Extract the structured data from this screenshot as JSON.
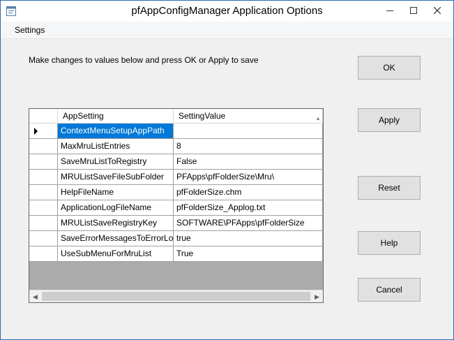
{
  "window": {
    "title": "pfAppConfigManager Application Options"
  },
  "menu": {
    "settings_label": "Settings"
  },
  "instruction": "Make changes to values below and press OK or Apply to save",
  "buttons": {
    "ok": "OK",
    "apply": "Apply",
    "reset": "Reset",
    "help": "Help",
    "cancel": "Cancel"
  },
  "grid": {
    "columns": [
      "AppSetting",
      "SettingValue"
    ],
    "rows": [
      {
        "setting": "ContextMenuSetupAppPath",
        "value": "",
        "selected": true
      },
      {
        "setting": "MaxMruListEntries",
        "value": "8"
      },
      {
        "setting": "SaveMruListToRegistry",
        "value": "False"
      },
      {
        "setting": "MRUListSaveFileSubFolder",
        "value": "PFApps\\pfFolderSize\\Mru\\"
      },
      {
        "setting": "HelpFileName",
        "value": "pfFolderSize.chm"
      },
      {
        "setting": "ApplicationLogFileName",
        "value": "pfFolderSize_Applog.txt"
      },
      {
        "setting": "MRUListSaveRegistryKey",
        "value": "SOFTWARE\\PFApps\\pfFolderSize"
      },
      {
        "setting": "SaveErrorMessagesToErrorLog",
        "value": "true"
      },
      {
        "setting": "UseSubMenuForMruList",
        "value": "True"
      }
    ]
  },
  "icons": {
    "app": "app-window-icon",
    "minimize": "minimize-icon",
    "maximize": "maximize-icon",
    "close": "close-icon",
    "current_row": "current-row-marker-icon",
    "sort": "sort-glyph-icon",
    "scroll_left": "scroll-left-arrow-icon",
    "scroll_right": "scroll-right-arrow-icon"
  },
  "colors": {
    "selection": "#0078d7",
    "window_border": "#2b6cb0",
    "background": "#f0f0f0",
    "grid_empty": "#ababab"
  }
}
